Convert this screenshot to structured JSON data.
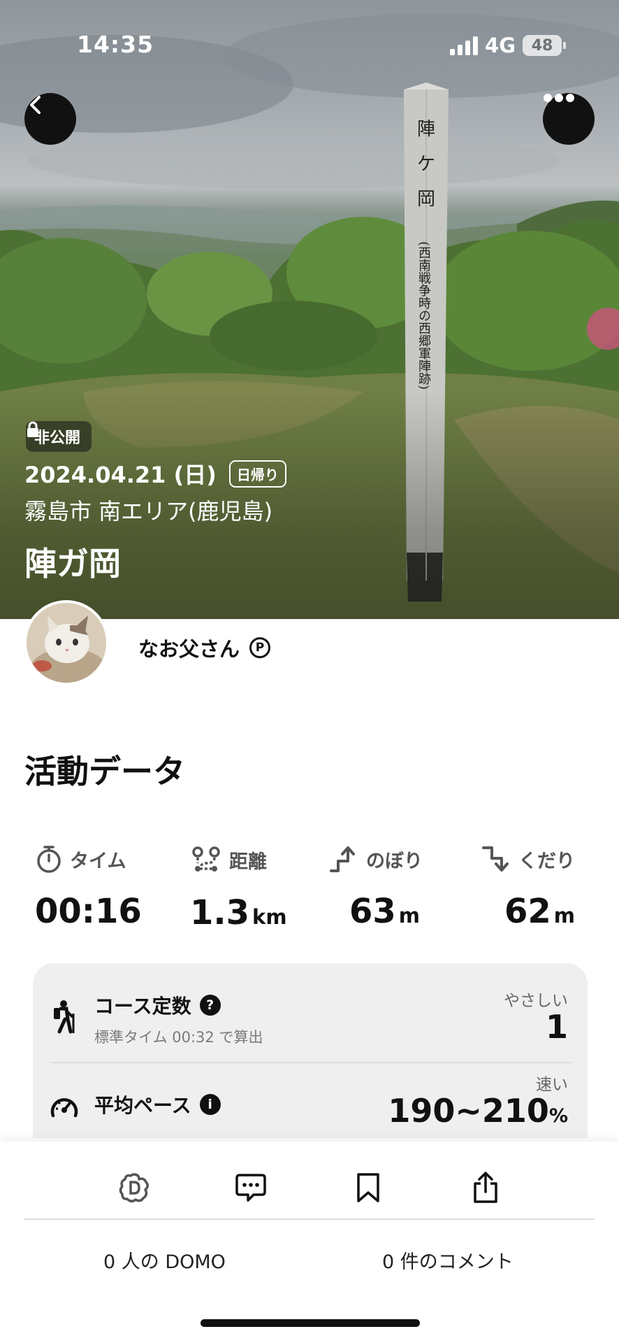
{
  "status_bar": {
    "time": "14:35",
    "network": "4G",
    "battery": "48"
  },
  "hero": {
    "visibility_badge": "非公開",
    "date": "2024.04.21 (日)",
    "trip_type": "日帰り",
    "area": "霧島市 南エリア(鹿児島)",
    "mountain_name": "陣ガ岡",
    "post_text": [
      "陣",
      "ケ",
      "岡"
    ],
    "post_subtext": "(西南戦争時の西郷軍陣跡)"
  },
  "user": {
    "name": "なお父さん",
    "badge": "P"
  },
  "activity": {
    "title": "活動データ",
    "stats": [
      {
        "label": "タイム",
        "icon": "stopwatch-icon",
        "value": "00:16",
        "unit": ""
      },
      {
        "label": "距離",
        "icon": "route-icon",
        "value": "1.3",
        "unit": "km"
      },
      {
        "label": "のぼり",
        "icon": "ascent-icon",
        "value": "63",
        "unit": "m"
      },
      {
        "label": "くだり",
        "icon": "descent-icon",
        "value": "62",
        "unit": "m"
      }
    ],
    "course_constant": {
      "label": "コース定数",
      "sub": "標準タイム 00:32 で算出",
      "rating_label": "やさしい",
      "value": "1"
    },
    "average_pace": {
      "label": "平均ペース",
      "rating_label": "速い",
      "value": "190~210",
      "unit": "%"
    }
  },
  "bottom_bar": {
    "domo_count": "0 人の DOMO",
    "comment_count": "0 件のコメント"
  }
}
